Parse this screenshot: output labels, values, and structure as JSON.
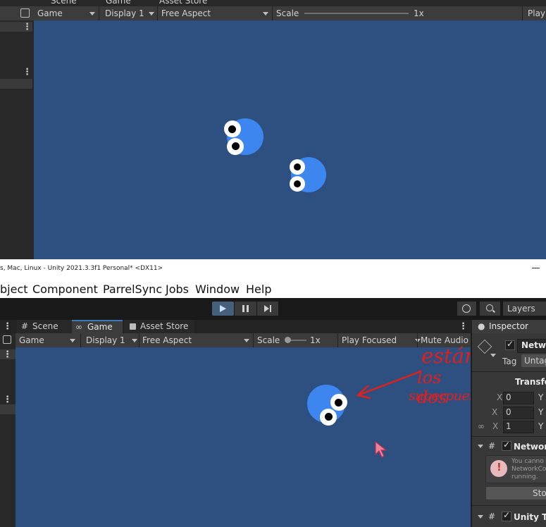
{
  "top": {
    "tabs": {
      "scene": "Scene",
      "game": "Game",
      "asset_store": "Asset Store"
    },
    "toolbar": {
      "game": "Game",
      "display": "Display 1",
      "aspect": "Free Aspect",
      "scale_label": "Scale",
      "scale_value": "1x",
      "play": "Play"
    }
  },
  "window": {
    "title": "s, Mac, Linux - Unity 2021.3.3f1 Personal* <DX11>",
    "menu": [
      "bject",
      "Component",
      "ParrelSync",
      "Jobs",
      "Window",
      "Help"
    ]
  },
  "bottom": {
    "layers": "Layers",
    "tabs": {
      "scene": "Scene",
      "game": "Game",
      "asset_store": "Asset Store",
      "inspector": "Inspector"
    },
    "toolbar": {
      "game": "Game",
      "display": "Display 1",
      "aspect": "Free Aspect",
      "scale_label": "Scale",
      "scale_value": "1x",
      "play_focused": "Play Focused",
      "mute_audio": "Mute Audio"
    },
    "annotation": {
      "line1": "están",
      "line2": "los dos",
      "line3": "superpuestos",
      "color": "#e0201c"
    }
  },
  "inspector": {
    "object_name": "Netwo",
    "tag_label": "Tag",
    "tag_value": "Untag",
    "transform": "Transfo",
    "row1_x": "0",
    "row1_y": "Y",
    "row2_x": "0",
    "row2_y": "Y",
    "row3_x_label": "X",
    "row3_x": "1",
    "row3_y": "Y",
    "network_component": "Network",
    "warning_line1": "You canno",
    "warning_line2": "NetworkCo",
    "warning_line3": "running.",
    "stop": "Sto",
    "unity_transport": "Unity Tr"
  },
  "colors": {
    "game_bg": "#2d4f80",
    "blob": "#3d86f0",
    "panel": "#383838"
  }
}
